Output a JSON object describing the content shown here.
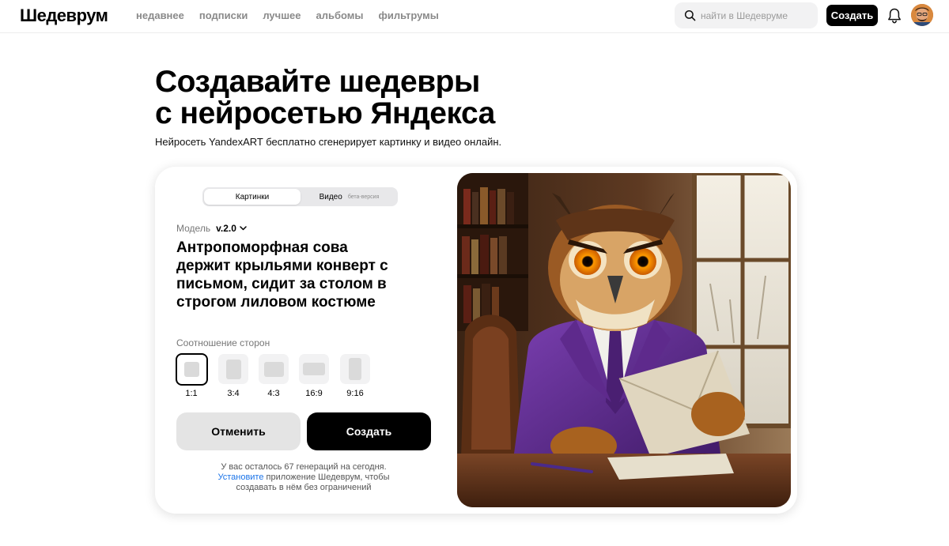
{
  "header": {
    "logo": "Шедеврум",
    "nav": [
      "недавнее",
      "подписки",
      "лучшее",
      "альбомы",
      "фильтрумы"
    ],
    "search_placeholder": "найти в Шедевруме",
    "create_label": "Создать"
  },
  "hero": {
    "title_line1": "Создавайте шедевры",
    "title_line2": "с нейросетью Яндекса",
    "subtitle": "Нейросеть YandexART бесплатно сгенерирует картинку и видео онлайн."
  },
  "generator": {
    "tabs": {
      "images": "Картинки",
      "video": "Видео",
      "video_badge": "бета-версия"
    },
    "model_label": "Модель",
    "model_value": "v.2.0",
    "prompt_lines": [
      "Антропоморфная сова",
      "держит крыльями конверт с",
      "письмом, сидит за столом в",
      "строгом лиловом костюме"
    ],
    "ratio_label": "Соотношение сторон",
    "ratios": [
      "1:1",
      "3:4",
      "4:3",
      "16:9",
      "9:16"
    ],
    "selected_ratio": "1:1",
    "cancel_label": "Отменить",
    "create_label": "Создать",
    "note_line1": "У вас осталось 67 генераций на сегодня.",
    "note_link": "Установите",
    "note_line2_rest": " приложение Шедеврум, чтобы",
    "note_line3": "создавать в нём без ограничений"
  },
  "colors": {
    "accent": "#000000",
    "link": "#1a73e8",
    "suit": "#5b2a86"
  }
}
